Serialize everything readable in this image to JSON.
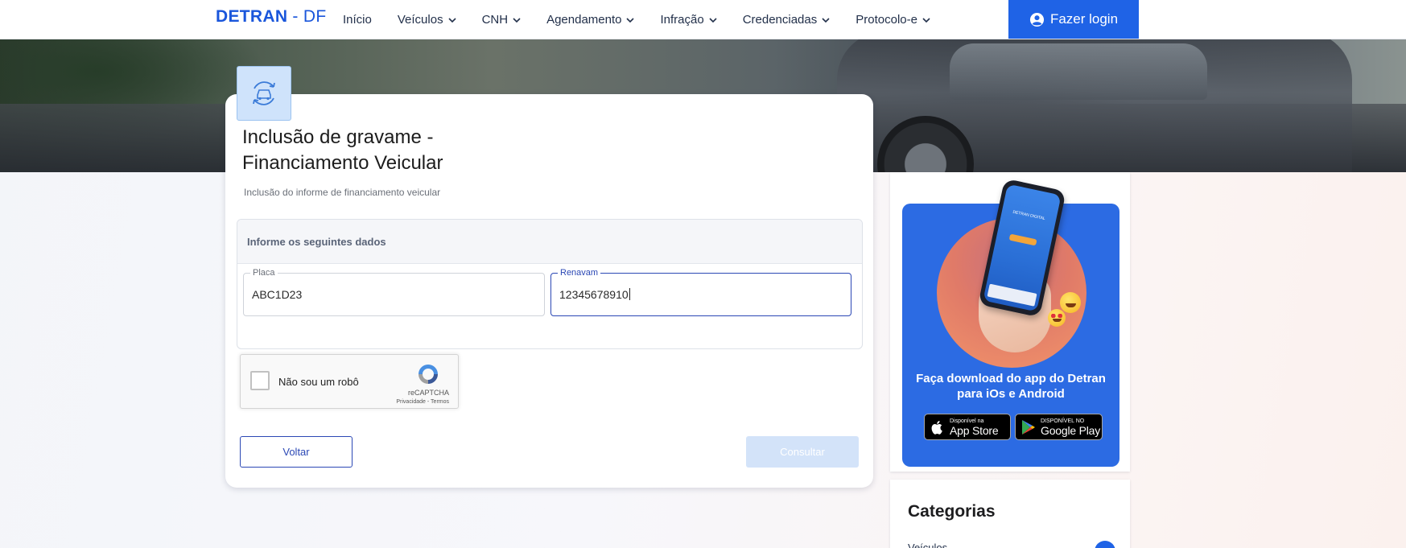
{
  "header": {
    "logo_main": "DETRAN",
    "logo_sep": " - ",
    "logo_sub": "DF",
    "nav": [
      {
        "label": "Início",
        "has_dropdown": false
      },
      {
        "label": "Veículos",
        "has_dropdown": true
      },
      {
        "label": "CNH",
        "has_dropdown": true
      },
      {
        "label": "Agendamento",
        "has_dropdown": true
      },
      {
        "label": "Infração",
        "has_dropdown": true
      },
      {
        "label": "Credenciadas",
        "has_dropdown": true
      },
      {
        "label": "Protocolo-e",
        "has_dropdown": true
      }
    ],
    "login_label": "Fazer login"
  },
  "service": {
    "icon": "car-refresh-icon",
    "title": "Inclusão de gravame - Financiamento Veicular",
    "subtitle": "Inclusão do informe de financiamento veicular"
  },
  "form": {
    "section_title": "Informe os seguintes dados",
    "placa": {
      "label": "Placa",
      "value": "ABC1D23"
    },
    "renavam": {
      "label": "Renavam",
      "value": "12345678910"
    }
  },
  "captcha": {
    "label": "Não sou um robô",
    "brand": "reCAPTCHA",
    "links": "Privacidade - Termos",
    "checked": false
  },
  "actions": {
    "back_label": "Voltar",
    "submit_label": "Consultar",
    "submit_enabled": false
  },
  "sidebar": {
    "app_promo": "Faça download do app do Detran para iOs e Android",
    "phone_screen_text": "DETRAN DIGITAL",
    "app_store": {
      "small": "Disponível na",
      "big": "App Store"
    },
    "google_play": {
      "small": "DISPONÍVEL NO",
      "big": "Google Play"
    },
    "categories_title": "Categorias",
    "first_category": "Veículos"
  },
  "colors": {
    "primary": "#1f63e6",
    "accent_border": "#2b48b5",
    "icon_bg": "#cfe3fb",
    "disabled_btn": "#d3e3f9"
  }
}
